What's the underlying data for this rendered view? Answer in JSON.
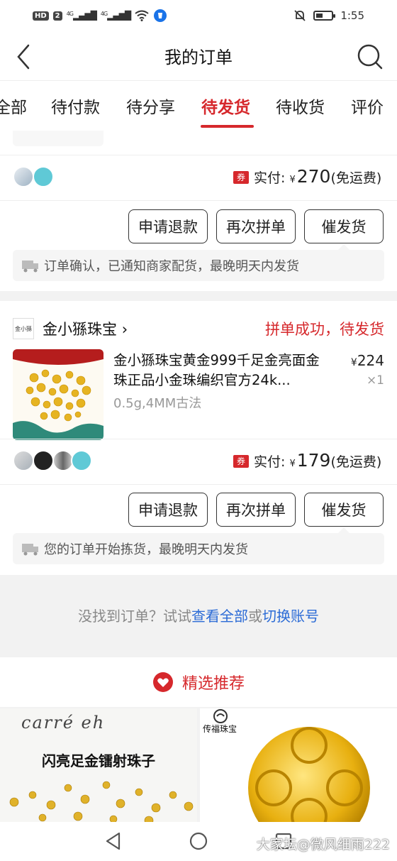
{
  "status_bar": {
    "hd": "HD",
    "sim": "2",
    "net1": "4G",
    "net2": "4G",
    "time": "1:55",
    "battery_level": 0.45
  },
  "header": {
    "title": "我的订单"
  },
  "tabs": [
    {
      "label": "全部"
    },
    {
      "label": "待付款"
    },
    {
      "label": "待分享"
    },
    {
      "label": "待发货",
      "active": true
    },
    {
      "label": "待收货"
    },
    {
      "label": "评价"
    }
  ],
  "order1": {
    "coupon": "券",
    "paid_label": "实付:",
    "currency": "¥",
    "amount": "270",
    "shipping": "(免运费)",
    "buttons": {
      "refund": "申请退款",
      "regroup": "再次拼单",
      "urge": "催发货"
    },
    "notice": "订单确认，已通知商家配货，最晚明天内发货"
  },
  "order2": {
    "shop_logo": "金小猻",
    "shop_name": "金小猻珠宝",
    "status": "拼单成功，待发货",
    "product": {
      "title": "金小猻珠宝黄金999千足金亮面金珠正品小金珠编织官方24k...",
      "spec": "0.5g,4MM古法",
      "currency": "¥",
      "price": "224",
      "qty": "×1"
    },
    "coupon": "券",
    "paid_label": "实付:",
    "currency": "¥",
    "amount": "179",
    "shipping": "(免运费)",
    "buttons": {
      "refund": "申请退款",
      "regroup": "再次拼单",
      "urge": "催发货"
    },
    "notice": "您的订单开始拣货，最晚明天内发货"
  },
  "empty_tip": {
    "prefix": "没找到订单？试试",
    "link_all": "查看全部",
    "or": "或",
    "link_switch": "切换账号"
  },
  "recommend": {
    "title": "精选推荐",
    "left_caption": "闪亮足金镭射珠子",
    "left_script": "carré   eh",
    "right_brand": "传福珠宝"
  },
  "watermark": "大家坛@微风细雨222",
  "colors": {
    "accent": "#d6282c",
    "link": "#2b6bd6"
  }
}
